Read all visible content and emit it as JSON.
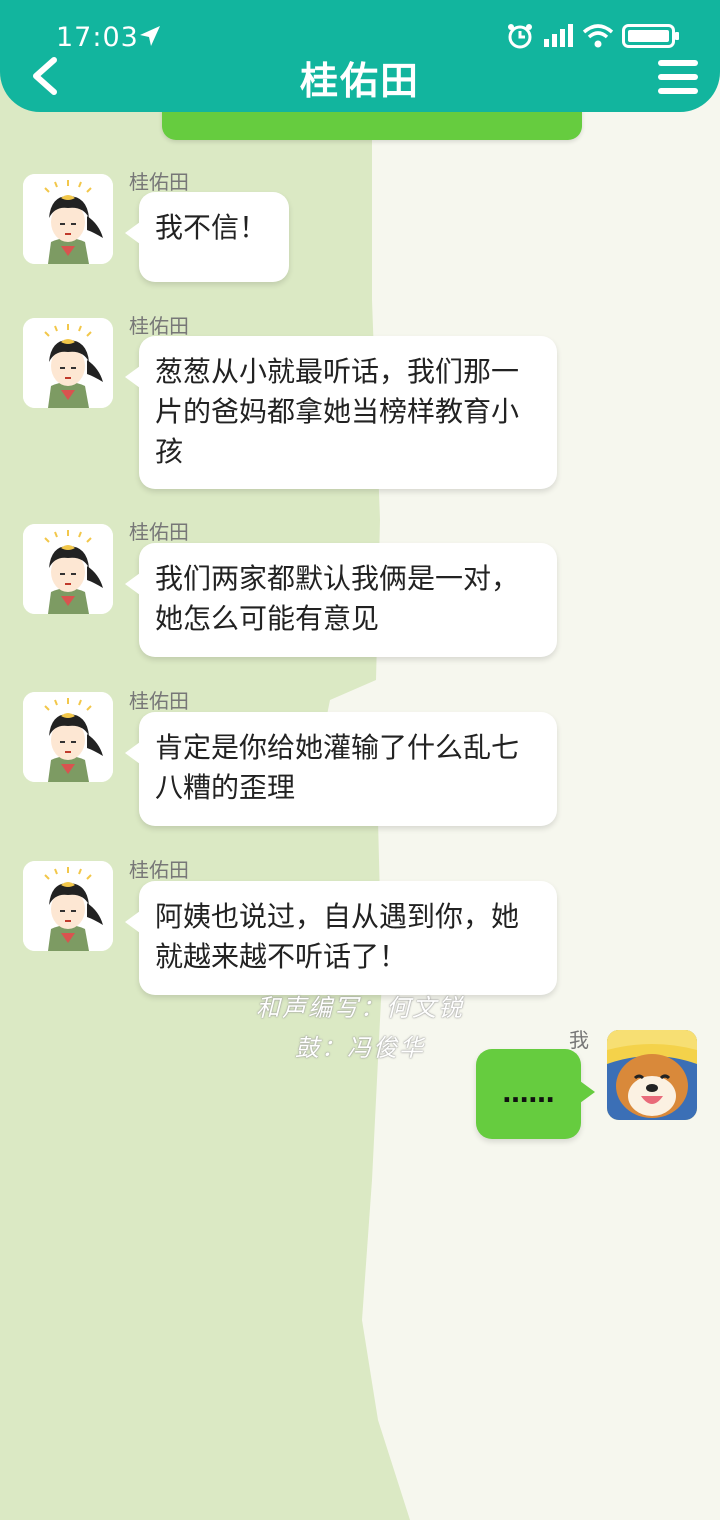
{
  "status_bar": {
    "time": "17:03"
  },
  "header": {
    "title": "桂佑田"
  },
  "messages": [
    {
      "sender": "桂佑田",
      "text": "我不信！"
    },
    {
      "sender": "桂佑田",
      "text": "葱葱从小就最听话，我们那一片的爸妈都拿她当榜样教育小孩"
    },
    {
      "sender": "桂佑田",
      "text": "我们两家都默认我俩是一对，她怎么可能有意见"
    },
    {
      "sender": "桂佑田",
      "text": "肯定是你给她灌输了什么乱七八糟的歪理"
    },
    {
      "sender": "桂佑田",
      "text": "阿姨也说过，自从遇到你，她就越来越不听话了！"
    }
  ],
  "credits": {
    "line1": "和声编写：何文锐",
    "line2": "鼓：冯俊华"
  },
  "my_message": {
    "sender": "我",
    "text": "……"
  },
  "colors": {
    "header": "#12b59e",
    "my_bubble": "#66cc3f",
    "other_bubble": "#ffffff",
    "bg_left": "#dbe9c4",
    "bg_right": "#f6f7ee"
  }
}
